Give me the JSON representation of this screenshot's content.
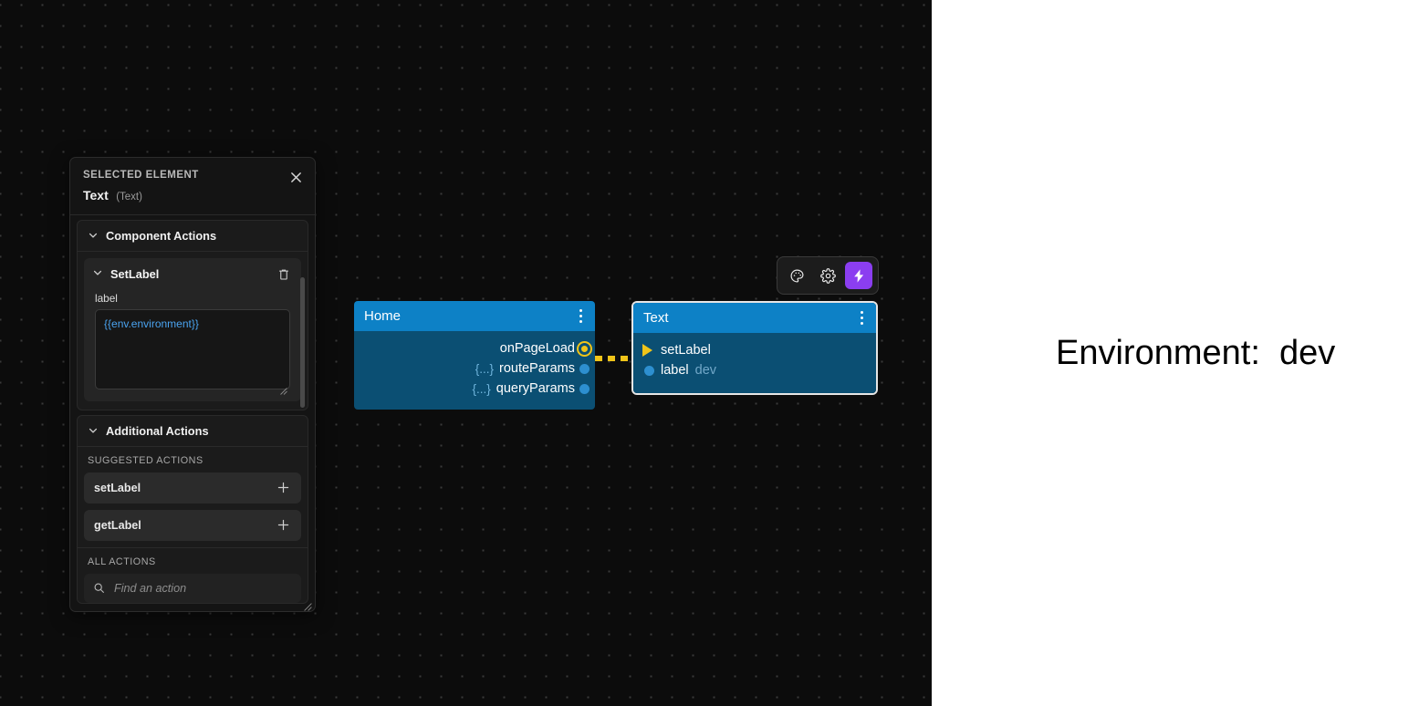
{
  "panel": {
    "eyebrow": "SELECTED ELEMENT",
    "title": "Text",
    "subtitle": "(Text)",
    "close_icon": "close-icon",
    "sections": {
      "component_actions": {
        "label": "Component Actions",
        "action": {
          "name": "SetLabel",
          "delete_icon": "trash-icon",
          "field_label": "label",
          "field_value": "{{env.environment}}"
        }
      },
      "additional_actions": {
        "label": "Additional Actions",
        "suggested_label": "SUGGESTED ACTIONS",
        "suggested": [
          {
            "name": "setLabel",
            "add_icon": "plus-icon"
          },
          {
            "name": "getLabel",
            "add_icon": "plus-icon"
          }
        ],
        "all_label": "ALL ACTIONS",
        "search_placeholder": "Find an action",
        "search_value": "",
        "search_icon": "search-icon"
      }
    }
  },
  "toolbar": {
    "buttons": [
      {
        "icon": "palette-icon",
        "active": false
      },
      {
        "icon": "gear-icon",
        "active": false
      },
      {
        "icon": "lightning-bolt-icon",
        "active": true
      }
    ]
  },
  "graph": {
    "nodes": [
      {
        "title": "Home",
        "menu_icon": "kebab-menu-icon",
        "ports": [
          {
            "type": "",
            "name": "onPageLoad",
            "dot": "event-ring"
          },
          {
            "type": "{...}",
            "name": "routeParams",
            "dot": "data"
          },
          {
            "type": "{...}",
            "name": "queryParams",
            "dot": "data"
          }
        ]
      },
      {
        "title": "Text",
        "menu_icon": "kebab-menu-icon",
        "selected": true,
        "inputs": [
          {
            "name": "setLabel",
            "value": "",
            "marker": "arrow"
          },
          {
            "name": "label",
            "value": "dev",
            "marker": "dot"
          }
        ]
      }
    ]
  },
  "preview": {
    "text": "Environment:  dev"
  },
  "colors": {
    "accent_purple": "#8b3ef0",
    "node_header_blue": "#0d81c6",
    "node_body_blue": "#0b4f73",
    "wire_yellow": "#f0c419",
    "port_blue": "#2d8fd0",
    "code_blue": "#4aa3f0",
    "canvas_bg": "#0c0c0c"
  }
}
